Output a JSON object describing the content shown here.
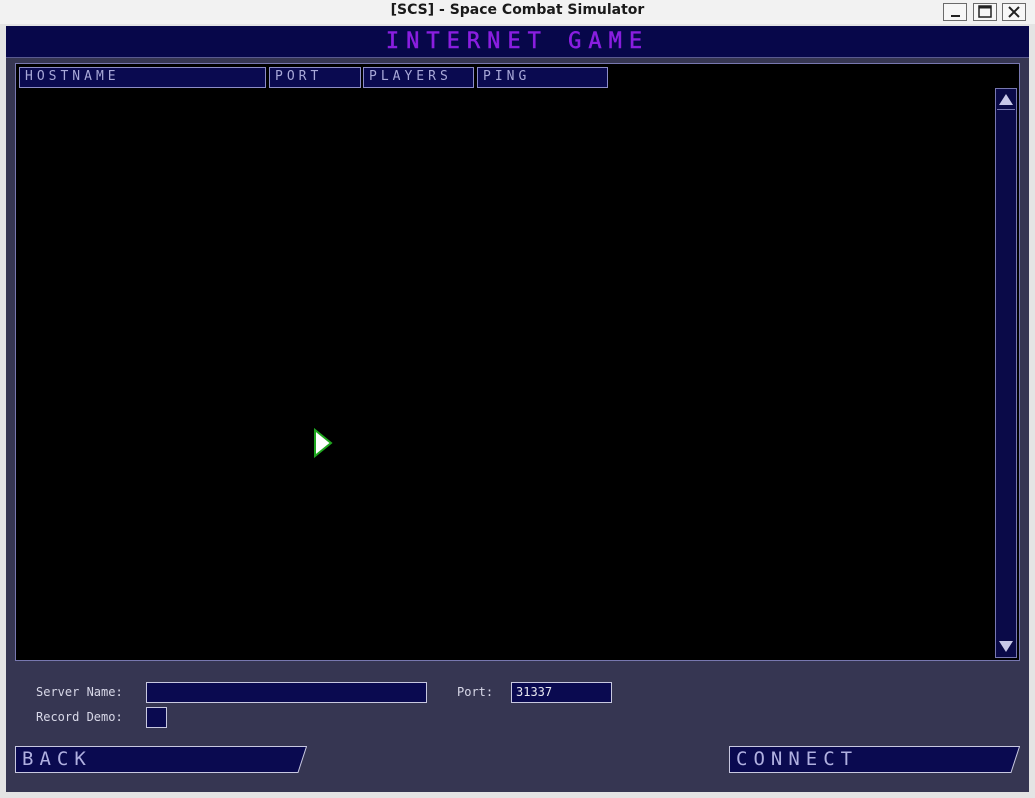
{
  "window": {
    "title": "[SCS] - Space Combat Simulator"
  },
  "header": {
    "title": "INTERNET GAME"
  },
  "server_list": {
    "columns": [
      "HOSTNAME",
      "PORT",
      "PLAYERS",
      "PING"
    ],
    "rows": []
  },
  "form": {
    "server_name_label": "Server Name:",
    "server_name_value": "",
    "port_label": "Port:",
    "port_value": "31337",
    "record_demo_label": "Record Demo:",
    "record_demo_checked": false
  },
  "buttons": {
    "back": "BACK",
    "connect": "CONNECT"
  },
  "icons": {
    "minimize": "minimize-icon",
    "maximize": "maximize-icon",
    "close": "close-icon",
    "scroll_up": "arrow-up-icon",
    "scroll_down": "arrow-down-icon",
    "cursor": "pointer-cursor-icon"
  },
  "colors": {
    "panel_background": "#363652",
    "header_background": "#07074a",
    "heading_text": "#8a1ee0",
    "field_background": "#0a0a50",
    "cursor_green": "#1fa61f"
  }
}
